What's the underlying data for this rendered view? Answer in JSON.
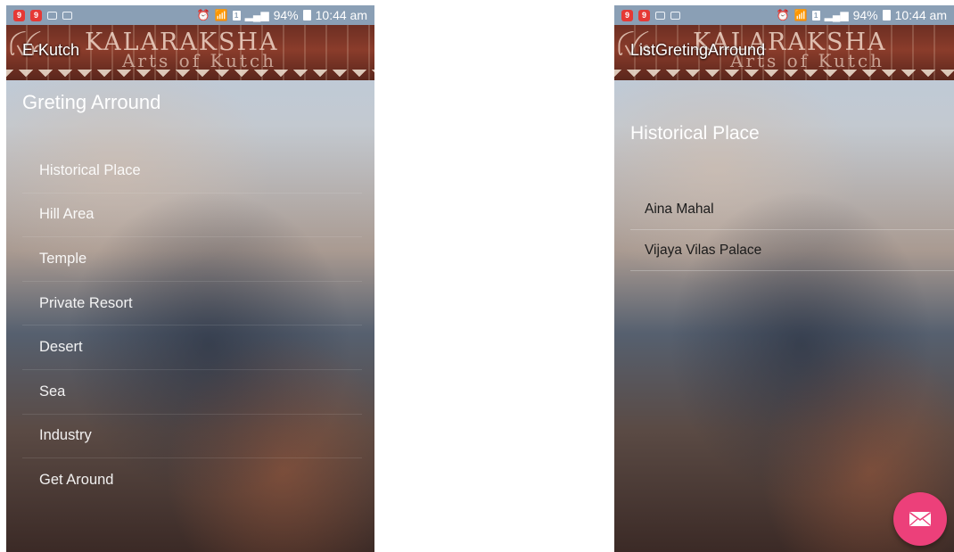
{
  "status_bar": {
    "battery": "94%",
    "time": "10:44 am",
    "notification_badge": "9",
    "sim_label": "1"
  },
  "banner": {
    "line1": "KALARAKSHA",
    "line2": "Arts of Kutch",
    "glyphs": "ꪶꪜꪀ"
  },
  "left_screen": {
    "app_title": "E-Kutch",
    "section_title": "Greting Arround",
    "menu_items": [
      {
        "label": "Historical Place"
      },
      {
        "label": "Hill Area"
      },
      {
        "label": "Temple"
      },
      {
        "label": "Private Resort"
      },
      {
        "label": "Desert"
      },
      {
        "label": "Sea"
      },
      {
        "label": "Industry"
      },
      {
        "label": "Get Around"
      }
    ]
  },
  "right_screen": {
    "app_title": "ListGretingArround",
    "section_title": "Historical Place",
    "places": [
      {
        "label": "Aina Mahal"
      },
      {
        "label": "Vijaya Vilas Palace"
      }
    ],
    "fab_icon": "mail-icon",
    "fab_color": "#ec407a"
  },
  "colors": {
    "toolbar": "#8a3c2b",
    "status_bar": "#8a9fb5"
  }
}
